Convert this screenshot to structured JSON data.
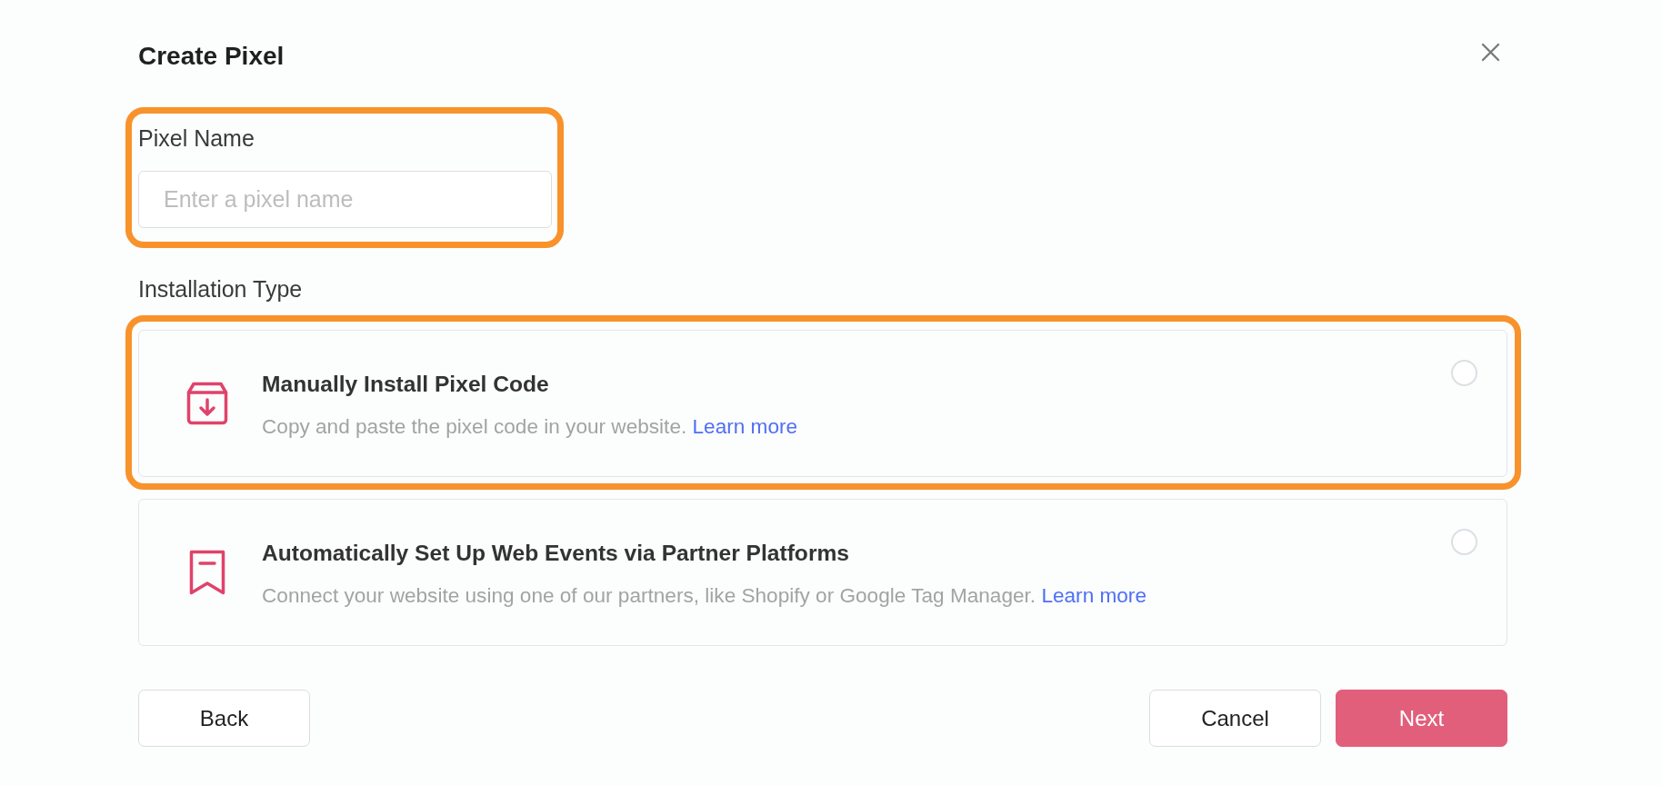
{
  "dialog": {
    "title": "Create Pixel"
  },
  "pixel_name": {
    "label": "Pixel Name",
    "placeholder": "Enter a pixel name",
    "highlighted": true
  },
  "installation_type": {
    "label": "Installation Type",
    "options": [
      {
        "kind": "manual",
        "title": "Manually Install Pixel Code",
        "description": "Copy and paste the pixel code in your website.",
        "link": "Learn more",
        "selected": false,
        "highlighted": true
      },
      {
        "kind": "partner",
        "title": "Automatically Set Up Web Events via Partner Platforms",
        "description": "Connect your website using one of our partners, like Shopify or Google Tag Manager.",
        "link": "Learn more",
        "selected": false,
        "highlighted": false
      }
    ]
  },
  "buttons": [
    {
      "label": "Back",
      "kind": "secondary"
    },
    {
      "label": "Cancel",
      "kind": "secondary"
    },
    {
      "label": "Next",
      "kind": "primary"
    }
  ]
}
